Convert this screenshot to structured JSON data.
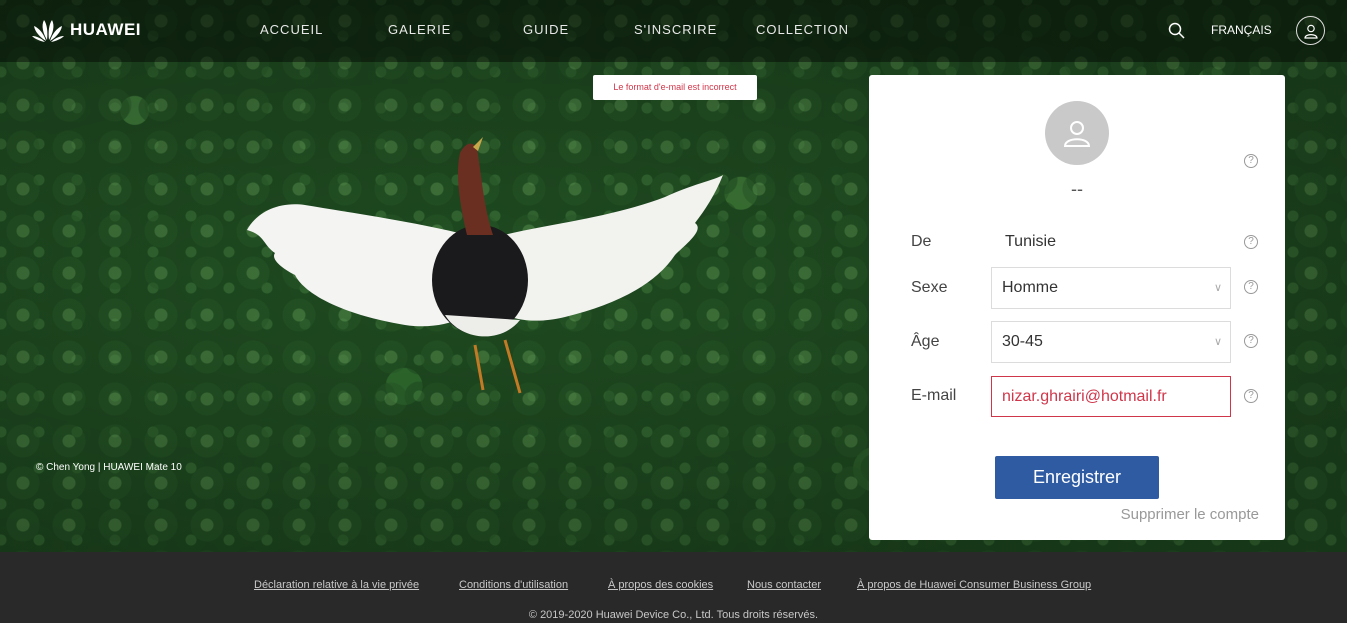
{
  "nav": {
    "brand": "HUAWEI",
    "items": [
      "ACCUEIL",
      "GALERIE",
      "GUIDE",
      "S'INSCRIRE",
      "COLLECTION"
    ],
    "language": "FRANÇAIS"
  },
  "hero": {
    "credit": "© Chen Yong | HUAWEI Mate 10"
  },
  "error_tip": "Le format d'e-mail est incorrect",
  "profile": {
    "username": "--",
    "fields": {
      "from_label": "De",
      "from_value": "Tunisie",
      "sex_label": "Sexe",
      "sex_value": "Homme",
      "age_label": "Âge",
      "age_value": "30-45",
      "email_label": "E-mail",
      "email_value": "nizar.ghrairi@hotmail.fr"
    },
    "save_label": "Enregistrer",
    "delete_label": "Supprimer le compte",
    "help_glyph": "?"
  },
  "footer": {
    "links": [
      "Déclaration relative à la vie privée",
      "Conditions d'utilisation",
      "À propos des cookies",
      "Nous contacter",
      "À propos de Huawei Consumer Business Group"
    ],
    "copyright": "© 2019-2020 Huawei Device Co., Ltd. Tous droits réservés."
  },
  "colors": {
    "accent": "#2f5ba3",
    "error": "#d0364a",
    "footer_bg": "#292929"
  }
}
